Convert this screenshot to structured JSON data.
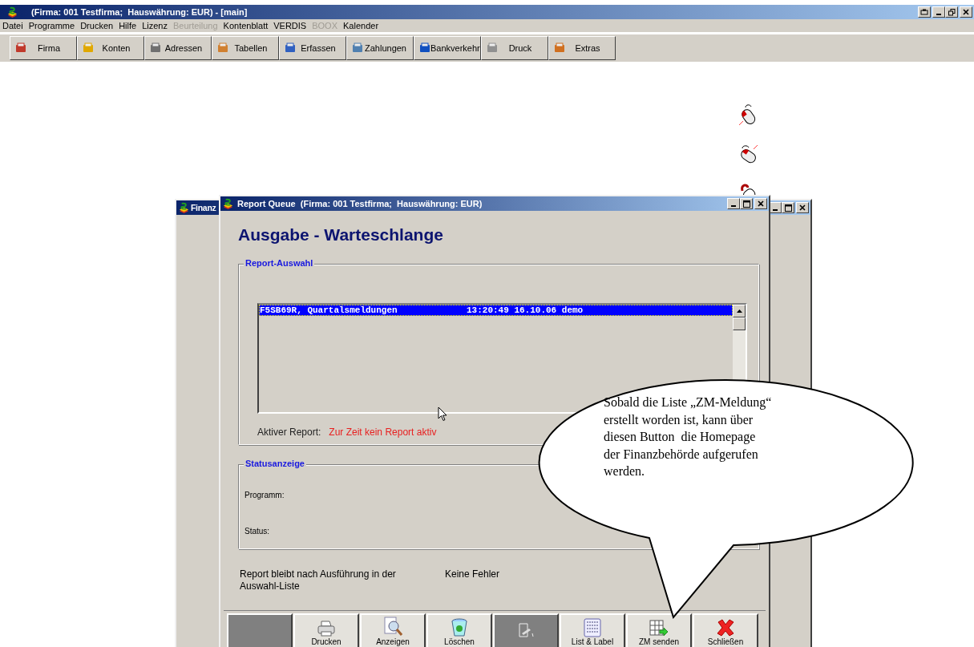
{
  "window": {
    "title": "(Firma: 001 Testfirma;  Hauswährung: EUR) - [main]"
  },
  "menu": [
    {
      "label": "Datei",
      "disabled": false
    },
    {
      "label": "Programme",
      "disabled": false
    },
    {
      "label": "Drucken",
      "disabled": false
    },
    {
      "label": "Hilfe",
      "disabled": false
    },
    {
      "label": "Lizenz",
      "disabled": false
    },
    {
      "label": "Beurteilung",
      "disabled": true
    },
    {
      "label": "Kontenblatt",
      "disabled": false
    },
    {
      "label": "VERDIS",
      "disabled": false
    },
    {
      "label": "BOOX",
      "disabled": true
    },
    {
      "label": "Kalender",
      "disabled": false
    }
  ],
  "toolbar": [
    {
      "label": "Firma",
      "kind": "firma"
    },
    {
      "label": "Konten",
      "kind": "konten"
    },
    {
      "label": "Adressen",
      "kind": "adressen"
    },
    {
      "label": "Tabellen",
      "kind": "tabellen"
    },
    {
      "label": "Erfassen",
      "kind": "erfassen"
    },
    {
      "label": "Zahlungen",
      "kind": "zahlungen"
    },
    {
      "label": "Bankverkehr",
      "kind": "bank"
    },
    {
      "label": "Druck",
      "kind": "druck"
    },
    {
      "label": "Extras",
      "kind": "extras"
    }
  ],
  "back_window": {
    "title": "Finanz"
  },
  "report_queue": {
    "title": "Report Queue  (Firma: 001 Testfirma;  Hauswährung: EUR)",
    "heading": "Ausgabe - Warteschlange",
    "report_group": {
      "legend": "Report-Auswahl",
      "rows": [
        {
          "column_1": "F5SB69R, Quartalsmeldungen",
          "column_2": "13:20:49 16.10.06 demo",
          "selected": true
        }
      ],
      "active_label": "Aktiver Report:",
      "active_value": "Zur Zeit kein Report aktiv"
    },
    "status_group": {
      "legend": "Statusanzeige",
      "fields": [
        {
          "label": "Programm:"
        },
        {
          "label": "Status:"
        }
      ]
    },
    "note": "Report bleibt nach Ausführung in der Auswahl-Liste",
    "error_status": "Keine Fehler",
    "buttons": [
      {
        "kind": "blank",
        "disabled": true
      },
      {
        "kind": "print",
        "label": "Drucken",
        "disabled": false
      },
      {
        "kind": "view",
        "label": "Anzeigen",
        "disabled": false
      },
      {
        "kind": "delete",
        "label": "Löschen",
        "disabled": false
      },
      {
        "kind": "edit",
        "disabled": true
      },
      {
        "kind": "list",
        "label": "List & Label",
        "disabled": false
      },
      {
        "kind": "send",
        "label": "ZM senden",
        "disabled": false
      },
      {
        "kind": "close",
        "label": "Schließen",
        "disabled": false
      }
    ]
  },
  "callout": {
    "lines": [
      "Sobald die Liste „ZM-Meldung“",
      "erstellt worden ist, kann über",
      "diesen Button  die Homepage",
      "der Finanzbehörde aufgerufen",
      "werden."
    ]
  }
}
